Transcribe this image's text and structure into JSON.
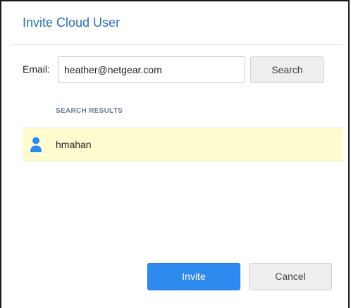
{
  "dialog": {
    "title": "Invite Cloud User"
  },
  "search": {
    "email_label": "Email:",
    "email_value": "heather@netgear.com",
    "search_label": "Search"
  },
  "results": {
    "header": "SEARCH RESULTS",
    "items": [
      {
        "name": "hmahan",
        "icon": "user-icon"
      }
    ]
  },
  "actions": {
    "invite_label": "Invite",
    "cancel_label": "Cancel"
  },
  "colors": {
    "title": "#2a6ebb",
    "primary_button": "#2f8af0",
    "selected_row": "#fdfccf",
    "user_icon": "#2f8af0"
  }
}
